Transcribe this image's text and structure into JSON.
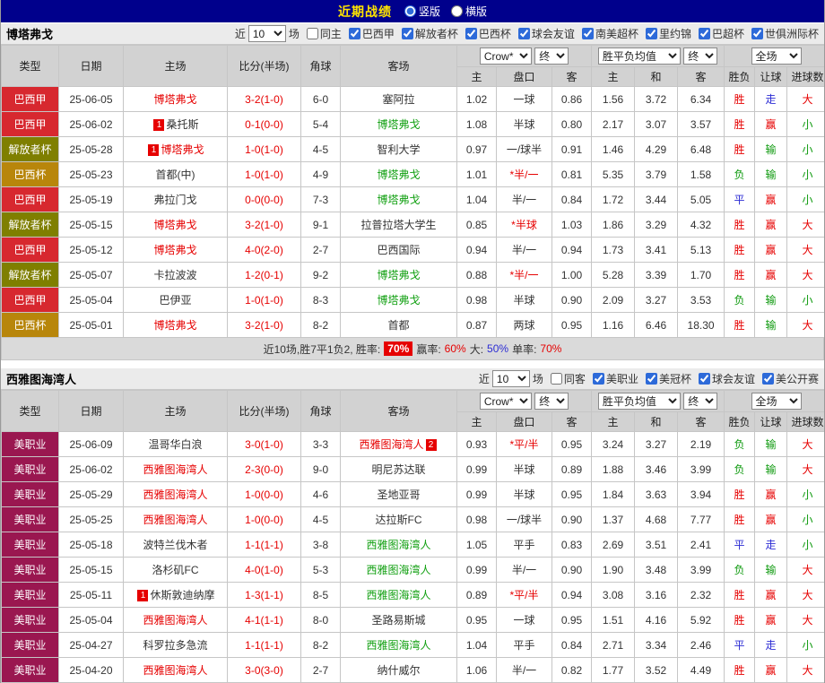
{
  "topbar": {
    "title": "近期战绩",
    "options": [
      {
        "label": "竖版",
        "selected": true
      },
      {
        "label": "横版",
        "selected": false
      }
    ]
  },
  "near": {
    "prefix": "近",
    "value": "10",
    "suffix": "场"
  },
  "table": {
    "columns": [
      "类型",
      "日期",
      "主场",
      "比分(半场)",
      "角球",
      "客场"
    ],
    "sub_columns": [
      "主",
      "盘口",
      "客",
      "主",
      "和",
      "客",
      "胜负",
      "让球",
      "进球数"
    ],
    "selects": {
      "bookmaker": "Crow*",
      "ah_final": "终",
      "avg": "胜平负均值",
      "eu_final": "终",
      "scope": "全场"
    }
  },
  "type_colors": {
    "巴西甲": "#d7282f",
    "解放者杯": "#7f7f00",
    "巴西杯": "#b8860b",
    "美职业": "#9a1750"
  },
  "sections": [
    {
      "team": "博塔弗戈",
      "filters": [
        {
          "label": "同主",
          "checked": false
        },
        {
          "label": "巴西甲",
          "checked": true
        },
        {
          "label": "解放者杯",
          "checked": true
        },
        {
          "label": "巴西杯",
          "checked": true
        },
        {
          "label": "球会友谊",
          "checked": true
        },
        {
          "label": "南美超杯",
          "checked": true
        },
        {
          "label": "里约锦",
          "checked": true
        },
        {
          "label": "巴超杯",
          "checked": true
        },
        {
          "label": "世俱洲际杯",
          "checked": true
        }
      ],
      "rows": [
        {
          "type": "巴西甲",
          "date": "25-06-05",
          "home": {
            "name": "博塔弗戈",
            "cls": "tracked-home"
          },
          "score": "3-2(1-0)",
          "corner": "6-0",
          "away": {
            "name": "塞阿拉"
          },
          "ah": {
            "h": "1.02",
            "line": "一球",
            "a": "0.86",
            "red": false
          },
          "eu": {
            "h": "1.56",
            "d": "3.72",
            "a": "6.34"
          },
          "res": [
            {
              "t": "胜",
              "c": "r"
            },
            {
              "t": "走",
              "c": "b"
            },
            {
              "t": "大",
              "c": "r"
            }
          ]
        },
        {
          "type": "巴西甲",
          "date": "25-06-02",
          "home": {
            "name": "桑托斯",
            "badge": "1",
            "badge_pos": "pre"
          },
          "score": "0-1(0-0)",
          "corner": "5-4",
          "away": {
            "name": "博塔弗戈",
            "cls": "tracked-away"
          },
          "ah": {
            "h": "1.08",
            "line": "半球",
            "a": "0.80",
            "red": false
          },
          "eu": {
            "h": "2.17",
            "d": "3.07",
            "a": "3.57"
          },
          "res": [
            {
              "t": "胜",
              "c": "r"
            },
            {
              "t": "赢",
              "c": "r"
            },
            {
              "t": "小",
              "c": "g"
            }
          ]
        },
        {
          "type": "解放者杯",
          "date": "25-05-28",
          "home": {
            "name": "博塔弗戈",
            "cls": "tracked-home",
            "badge": "1",
            "badge_pos": "pre"
          },
          "score": "1-0(1-0)",
          "corner": "4-5",
          "away": {
            "name": "智利大学"
          },
          "ah": {
            "h": "0.97",
            "line": "一/球半",
            "a": "0.91",
            "red": false
          },
          "eu": {
            "h": "1.46",
            "d": "4.29",
            "a": "6.48"
          },
          "res": [
            {
              "t": "胜",
              "c": "r"
            },
            {
              "t": "输",
              "c": "g"
            },
            {
              "t": "小",
              "c": "g"
            }
          ]
        },
        {
          "type": "巴西杯",
          "date": "25-05-23",
          "home": {
            "name": "首都(中)"
          },
          "score": "1-0(1-0)",
          "corner": "4-9",
          "away": {
            "name": "博塔弗戈",
            "cls": "tracked-away"
          },
          "ah": {
            "h": "1.01",
            "line": "*半/一",
            "a": "0.81",
            "red": true
          },
          "eu": {
            "h": "5.35",
            "d": "3.79",
            "a": "1.58"
          },
          "res": [
            {
              "t": "负",
              "c": "g"
            },
            {
              "t": "输",
              "c": "g"
            },
            {
              "t": "小",
              "c": "g"
            }
          ]
        },
        {
          "type": "巴西甲",
          "date": "25-05-19",
          "home": {
            "name": "弗拉门戈"
          },
          "score": "0-0(0-0)",
          "corner": "7-3",
          "away": {
            "name": "博塔弗戈",
            "cls": "tracked-away"
          },
          "ah": {
            "h": "1.04",
            "line": "半/一",
            "a": "0.84",
            "red": false
          },
          "eu": {
            "h": "1.72",
            "d": "3.44",
            "a": "5.05"
          },
          "res": [
            {
              "t": "平",
              "c": "b"
            },
            {
              "t": "赢",
              "c": "r"
            },
            {
              "t": "小",
              "c": "g"
            }
          ]
        },
        {
          "type": "解放者杯",
          "date": "25-05-15",
          "home": {
            "name": "博塔弗戈",
            "cls": "tracked-home"
          },
          "score": "3-2(1-0)",
          "corner": "9-1",
          "away": {
            "name": "拉普拉塔大学生"
          },
          "ah": {
            "h": "0.85",
            "line": "*半球",
            "a": "1.03",
            "red": true
          },
          "eu": {
            "h": "1.86",
            "d": "3.29",
            "a": "4.32"
          },
          "res": [
            {
              "t": "胜",
              "c": "r"
            },
            {
              "t": "赢",
              "c": "r"
            },
            {
              "t": "大",
              "c": "r"
            }
          ]
        },
        {
          "type": "巴西甲",
          "date": "25-05-12",
          "home": {
            "name": "博塔弗戈",
            "cls": "tracked-home"
          },
          "score": "4-0(2-0)",
          "corner": "2-7",
          "away": {
            "name": "巴西国际"
          },
          "ah": {
            "h": "0.94",
            "line": "半/一",
            "a": "0.94",
            "red": false
          },
          "eu": {
            "h": "1.73",
            "d": "3.41",
            "a": "5.13"
          },
          "res": [
            {
              "t": "胜",
              "c": "r"
            },
            {
              "t": "赢",
              "c": "r"
            },
            {
              "t": "大",
              "c": "r"
            }
          ]
        },
        {
          "type": "解放者杯",
          "date": "25-05-07",
          "home": {
            "name": "卡拉波波"
          },
          "score": "1-2(0-1)",
          "corner": "9-2",
          "away": {
            "name": "博塔弗戈",
            "cls": "tracked-away"
          },
          "ah": {
            "h": "0.88",
            "line": "*半/一",
            "a": "1.00",
            "red": true
          },
          "eu": {
            "h": "5.28",
            "d": "3.39",
            "a": "1.70"
          },
          "res": [
            {
              "t": "胜",
              "c": "r"
            },
            {
              "t": "赢",
              "c": "r"
            },
            {
              "t": "大",
              "c": "r"
            }
          ]
        },
        {
          "type": "巴西甲",
          "date": "25-05-04",
          "home": {
            "name": "巴伊亚"
          },
          "score": "1-0(1-0)",
          "corner": "8-3",
          "away": {
            "name": "博塔弗戈",
            "cls": "tracked-away"
          },
          "ah": {
            "h": "0.98",
            "line": "半球",
            "a": "0.90",
            "red": false
          },
          "eu": {
            "h": "2.09",
            "d": "3.27",
            "a": "3.53"
          },
          "res": [
            {
              "t": "负",
              "c": "g"
            },
            {
              "t": "输",
              "c": "g"
            },
            {
              "t": "小",
              "c": "g"
            }
          ]
        },
        {
          "type": "巴西杯",
          "date": "25-05-01",
          "home": {
            "name": "博塔弗戈",
            "cls": "tracked-home"
          },
          "score": "3-2(1-0)",
          "corner": "8-2",
          "away": {
            "name": "首都"
          },
          "ah": {
            "h": "0.87",
            "line": "两球",
            "a": "0.95",
            "red": false
          },
          "eu": {
            "h": "1.16",
            "d": "6.46",
            "a": "18.30"
          },
          "res": [
            {
              "t": "胜",
              "c": "r"
            },
            {
              "t": "输",
              "c": "g"
            },
            {
              "t": "大",
              "c": "r"
            }
          ]
        }
      ],
      "summary": {
        "prefix": "近10场,胜7平1负2, 胜率:",
        "win_rate": "70%",
        "stats": [
          {
            "label": "赢率:",
            "value": "60%",
            "cls": "r"
          },
          {
            "label": "大:",
            "value": "50%",
            "cls": "b"
          },
          {
            "label": "单率:",
            "value": "70%",
            "cls": "r"
          }
        ]
      }
    },
    {
      "team": "西雅图海湾人",
      "filters": [
        {
          "label": "同客",
          "checked": false
        },
        {
          "label": "美职业",
          "checked": true
        },
        {
          "label": "美冠杯",
          "checked": true
        },
        {
          "label": "球会友谊",
          "checked": true
        },
        {
          "label": "美公开赛",
          "checked": true
        }
      ],
      "rows": [
        {
          "type": "美职业",
          "date": "25-06-09",
          "home": {
            "name": "温哥华白浪"
          },
          "score": "3-0(1-0)",
          "corner": "3-3",
          "away": {
            "name": "西雅图海湾人",
            "cls": "tracked-home",
            "badge": "2",
            "badge_pos": "post"
          },
          "ah": {
            "h": "0.93",
            "line": "*平/半",
            "a": "0.95",
            "red": true
          },
          "eu": {
            "h": "3.24",
            "d": "3.27",
            "a": "2.19"
          },
          "res": [
            {
              "t": "负",
              "c": "g"
            },
            {
              "t": "输",
              "c": "g"
            },
            {
              "t": "大",
              "c": "r"
            }
          ]
        },
        {
          "type": "美职业",
          "date": "25-06-02",
          "home": {
            "name": "西雅图海湾人",
            "cls": "tracked-home"
          },
          "score": "2-3(0-0)",
          "corner": "9-0",
          "away": {
            "name": "明尼苏达联"
          },
          "ah": {
            "h": "0.99",
            "line": "半球",
            "a": "0.89",
            "red": false
          },
          "eu": {
            "h": "1.88",
            "d": "3.46",
            "a": "3.99"
          },
          "res": [
            {
              "t": "负",
              "c": "g"
            },
            {
              "t": "输",
              "c": "g"
            },
            {
              "t": "大",
              "c": "r"
            }
          ]
        },
        {
          "type": "美职业",
          "date": "25-05-29",
          "home": {
            "name": "西雅图海湾人",
            "cls": "tracked-home"
          },
          "score": "1-0(0-0)",
          "corner": "4-6",
          "away": {
            "name": "圣地亚哥"
          },
          "ah": {
            "h": "0.99",
            "line": "半球",
            "a": "0.95",
            "red": false
          },
          "eu": {
            "h": "1.84",
            "d": "3.63",
            "a": "3.94"
          },
          "res": [
            {
              "t": "胜",
              "c": "r"
            },
            {
              "t": "赢",
              "c": "r"
            },
            {
              "t": "小",
              "c": "g"
            }
          ]
        },
        {
          "type": "美职业",
          "date": "25-05-25",
          "home": {
            "name": "西雅图海湾人",
            "cls": "tracked-home"
          },
          "score": "1-0(0-0)",
          "corner": "4-5",
          "away": {
            "name": "达拉斯FC"
          },
          "ah": {
            "h": "0.98",
            "line": "一/球半",
            "a": "0.90",
            "red": false
          },
          "eu": {
            "h": "1.37",
            "d": "4.68",
            "a": "7.77"
          },
          "res": [
            {
              "t": "胜",
              "c": "r"
            },
            {
              "t": "赢",
              "c": "r"
            },
            {
              "t": "小",
              "c": "g"
            }
          ]
        },
        {
          "type": "美职业",
          "date": "25-05-18",
          "home": {
            "name": "波特兰伐木者"
          },
          "score": "1-1(1-1)",
          "corner": "3-8",
          "away": {
            "name": "西雅图海湾人",
            "cls": "tracked-away"
          },
          "ah": {
            "h": "1.05",
            "line": "平手",
            "a": "0.83",
            "red": false
          },
          "eu": {
            "h": "2.69",
            "d": "3.51",
            "a": "2.41"
          },
          "res": [
            {
              "t": "平",
              "c": "b"
            },
            {
              "t": "走",
              "c": "b"
            },
            {
              "t": "小",
              "c": "g"
            }
          ]
        },
        {
          "type": "美职业",
          "date": "25-05-15",
          "home": {
            "name": "洛杉矶FC"
          },
          "score": "4-0(1-0)",
          "corner": "5-3",
          "away": {
            "name": "西雅图海湾人",
            "cls": "tracked-away"
          },
          "ah": {
            "h": "0.99",
            "line": "半/一",
            "a": "0.90",
            "red": false
          },
          "eu": {
            "h": "1.90",
            "d": "3.48",
            "a": "3.99"
          },
          "res": [
            {
              "t": "负",
              "c": "g"
            },
            {
              "t": "输",
              "c": "g"
            },
            {
              "t": "大",
              "c": "r"
            }
          ]
        },
        {
          "type": "美职业",
          "date": "25-05-11",
          "home": {
            "name": "休斯敦迪纳摩",
            "badge": "1",
            "badge_pos": "pre"
          },
          "score": "1-3(1-1)",
          "corner": "8-5",
          "away": {
            "name": "西雅图海湾人",
            "cls": "tracked-away"
          },
          "ah": {
            "h": "0.89",
            "line": "*平/半",
            "a": "0.94",
            "red": true
          },
          "eu": {
            "h": "3.08",
            "d": "3.16",
            "a": "2.32"
          },
          "res": [
            {
              "t": "胜",
              "c": "r"
            },
            {
              "t": "赢",
              "c": "r"
            },
            {
              "t": "大",
              "c": "r"
            }
          ]
        },
        {
          "type": "美职业",
          "date": "25-05-04",
          "home": {
            "name": "西雅图海湾人",
            "cls": "tracked-home"
          },
          "score": "4-1(1-1)",
          "corner": "8-0",
          "away": {
            "name": "圣路易斯城"
          },
          "ah": {
            "h": "0.95",
            "line": "一球",
            "a": "0.95",
            "red": false
          },
          "eu": {
            "h": "1.51",
            "d": "4.16",
            "a": "5.92"
          },
          "res": [
            {
              "t": "胜",
              "c": "r"
            },
            {
              "t": "赢",
              "c": "r"
            },
            {
              "t": "大",
              "c": "r"
            }
          ]
        },
        {
          "type": "美职业",
          "date": "25-04-27",
          "home": {
            "name": "科罗拉多急流"
          },
          "score": "1-1(1-1)",
          "corner": "8-2",
          "away": {
            "name": "西雅图海湾人",
            "cls": "tracked-away"
          },
          "ah": {
            "h": "1.04",
            "line": "平手",
            "a": "0.84",
            "red": false
          },
          "eu": {
            "h": "2.71",
            "d": "3.34",
            "a": "2.46"
          },
          "res": [
            {
              "t": "平",
              "c": "b"
            },
            {
              "t": "走",
              "c": "b"
            },
            {
              "t": "小",
              "c": "g"
            }
          ]
        },
        {
          "type": "美职业",
          "date": "25-04-20",
          "home": {
            "name": "西雅图海湾人",
            "cls": "tracked-home"
          },
          "score": "3-0(3-0)",
          "corner": "2-7",
          "away": {
            "name": "纳什威尔"
          },
          "ah": {
            "h": "1.06",
            "line": "半/一",
            "a": "0.82",
            "red": false
          },
          "eu": {
            "h": "1.77",
            "d": "3.52",
            "a": "4.49"
          },
          "res": [
            {
              "t": "胜",
              "c": "r"
            },
            {
              "t": "赢",
              "c": "r"
            },
            {
              "t": "大",
              "c": "r"
            }
          ]
        }
      ],
      "summary": null
    }
  ]
}
